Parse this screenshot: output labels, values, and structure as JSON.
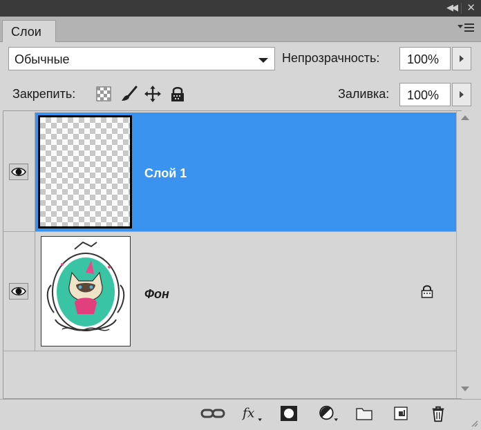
{
  "panel": {
    "tab_label": "Слои",
    "title_bar_icons": [
      "collapse-icon",
      "close-icon"
    ],
    "menu_icon": "panel-menu-icon"
  },
  "blend_mode": {
    "value": "Обычные"
  },
  "opacity": {
    "label": "Непрозрачность:",
    "value": "100%"
  },
  "lock": {
    "label": "Закрепить:",
    "icons": [
      "lock-transparent-pixels-icon",
      "lock-image-pixels-icon",
      "lock-position-icon",
      "lock-all-icon"
    ]
  },
  "fill": {
    "label": "Заливка:",
    "value": "100%"
  },
  "layers": [
    {
      "name": "Слой 1",
      "selected": true,
      "visible": true,
      "locked": false,
      "thumbnail": "transparent-checkerboard"
    },
    {
      "name": "Фон",
      "selected": false,
      "visible": true,
      "locked": true,
      "thumbnail": "cat-in-frame-illustration"
    }
  ],
  "footer_icons": [
    "link-layers-icon",
    "layer-style-fx-icon",
    "add-mask-icon",
    "adjustment-layer-icon",
    "new-group-icon",
    "new-layer-icon",
    "delete-layer-icon"
  ],
  "colors": {
    "selection": "#3b93f0",
    "panel_bg": "#d6d6d6",
    "title_bar": "#3a3a3a"
  }
}
